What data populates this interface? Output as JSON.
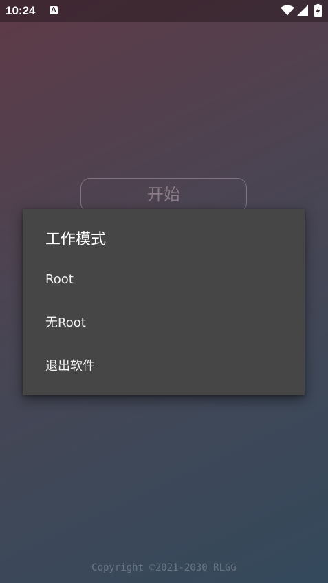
{
  "status_bar": {
    "time": "10:24",
    "notification_icon": "text-a-icon",
    "notification_glyph": "A",
    "icons": [
      "wifi-icon",
      "signal-icon",
      "battery-charging-icon"
    ]
  },
  "main": {
    "start_button_label": "开始"
  },
  "dialog": {
    "title": "工作模式",
    "items": [
      {
        "label": "Root"
      },
      {
        "label": "无Root"
      },
      {
        "label": "退出软件"
      }
    ]
  },
  "footer": {
    "copyright": "Copyright ©2021-2030 RLGG"
  },
  "colors": {
    "dialog_bg": "#464646",
    "text": "#ffffff"
  }
}
